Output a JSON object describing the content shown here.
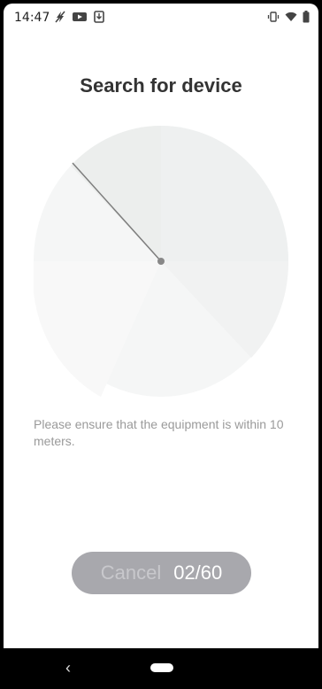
{
  "status_bar": {
    "time": "14:47",
    "left_icons": [
      "no-bolt-icon",
      "youtube-icon",
      "download-icon"
    ],
    "right_icons": [
      "vibrate-icon",
      "wifi-icon",
      "battery-icon"
    ]
  },
  "page": {
    "title": "Search for device",
    "hint": "Please ensure that the equipment is within 10 meters."
  },
  "action": {
    "cancel_label": "Cancel",
    "counter": "02/60"
  },
  "nav_bar": {
    "back_glyph": "‹"
  },
  "colors": {
    "title": "#333333",
    "hint": "#9a9a9a",
    "button_bg": "#a8a8ad",
    "radar_fill": "#f2f3f3",
    "radar_needle": "#7d7d7d"
  }
}
